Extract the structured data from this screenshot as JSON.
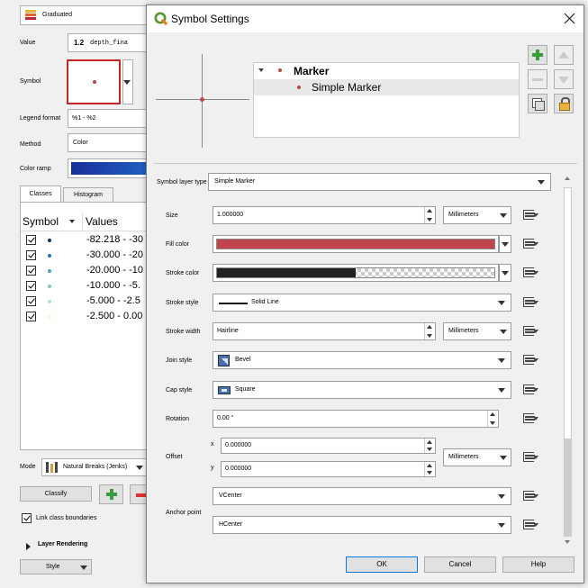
{
  "background": {
    "renderer": "Graduated",
    "value_label": "Value",
    "value_prefix": "1.2",
    "value_field": "depth_fina",
    "symbol_label": "Symbol",
    "legend_format_label": "Legend format",
    "legend_format": "%1 - %2",
    "method_label": "Method",
    "method": "Color",
    "color_ramp_label": "Color ramp",
    "tabs": [
      "Classes",
      "Histogram"
    ],
    "columns": [
      "Symbol",
      "Values"
    ],
    "classes": [
      {
        "value": "-82.218 - -30",
        "color": "#08306b"
      },
      {
        "value": "-30.000 - -20",
        "color": "#2171b5"
      },
      {
        "value": "-20.000 - -10",
        "color": "#4aa3c8"
      },
      {
        "value": "-10.000 - -5.",
        "color": "#7fc6c0"
      },
      {
        "value": "-5.000 - -2.5",
        "color": "#b6e0cf"
      },
      {
        "value": "-2.500 - 0.00",
        "color": "#f2f7d8"
      }
    ],
    "mode_label": "Mode",
    "mode": "Natural Breaks (Jenks)",
    "classify": "Classify",
    "link_class": "Link class boundaries",
    "layer_rendering": "Layer Rendering",
    "style": "Style"
  },
  "dialog": {
    "title": "Symbol Settings",
    "tree": {
      "root": "Marker",
      "child": "Simple Marker"
    },
    "symbol_layer_type_label": "Symbol layer type",
    "symbol_layer_type": "Simple Marker",
    "size_label": "Size",
    "size": "1.000000",
    "size_unit": "Millimeters",
    "fill_color_label": "Fill color",
    "fill_color": "#c0454c",
    "stroke_color_label": "Stroke color",
    "stroke_color": "#222222",
    "stroke_style_label": "Stroke style",
    "stroke_style": "Solid Line",
    "stroke_width_label": "Stroke width",
    "stroke_width": "Hairline",
    "stroke_width_unit": "Millimeters",
    "join_style_label": "Join style",
    "join_style": "Bevel",
    "cap_style_label": "Cap style",
    "cap_style": "Square",
    "rotation_label": "Rotation",
    "rotation": "0.00 °",
    "offset_label": "Offset",
    "offset_x_label": "x",
    "offset_x": "0.000000",
    "offset_y_label": "y",
    "offset_y": "0.000000",
    "offset_unit": "Millimeters",
    "anchor_point_label": "Anchor point",
    "anchor_v": "VCenter",
    "anchor_h": "HCenter",
    "ok": "OK",
    "cancel": "Cancel",
    "help": "Help"
  }
}
